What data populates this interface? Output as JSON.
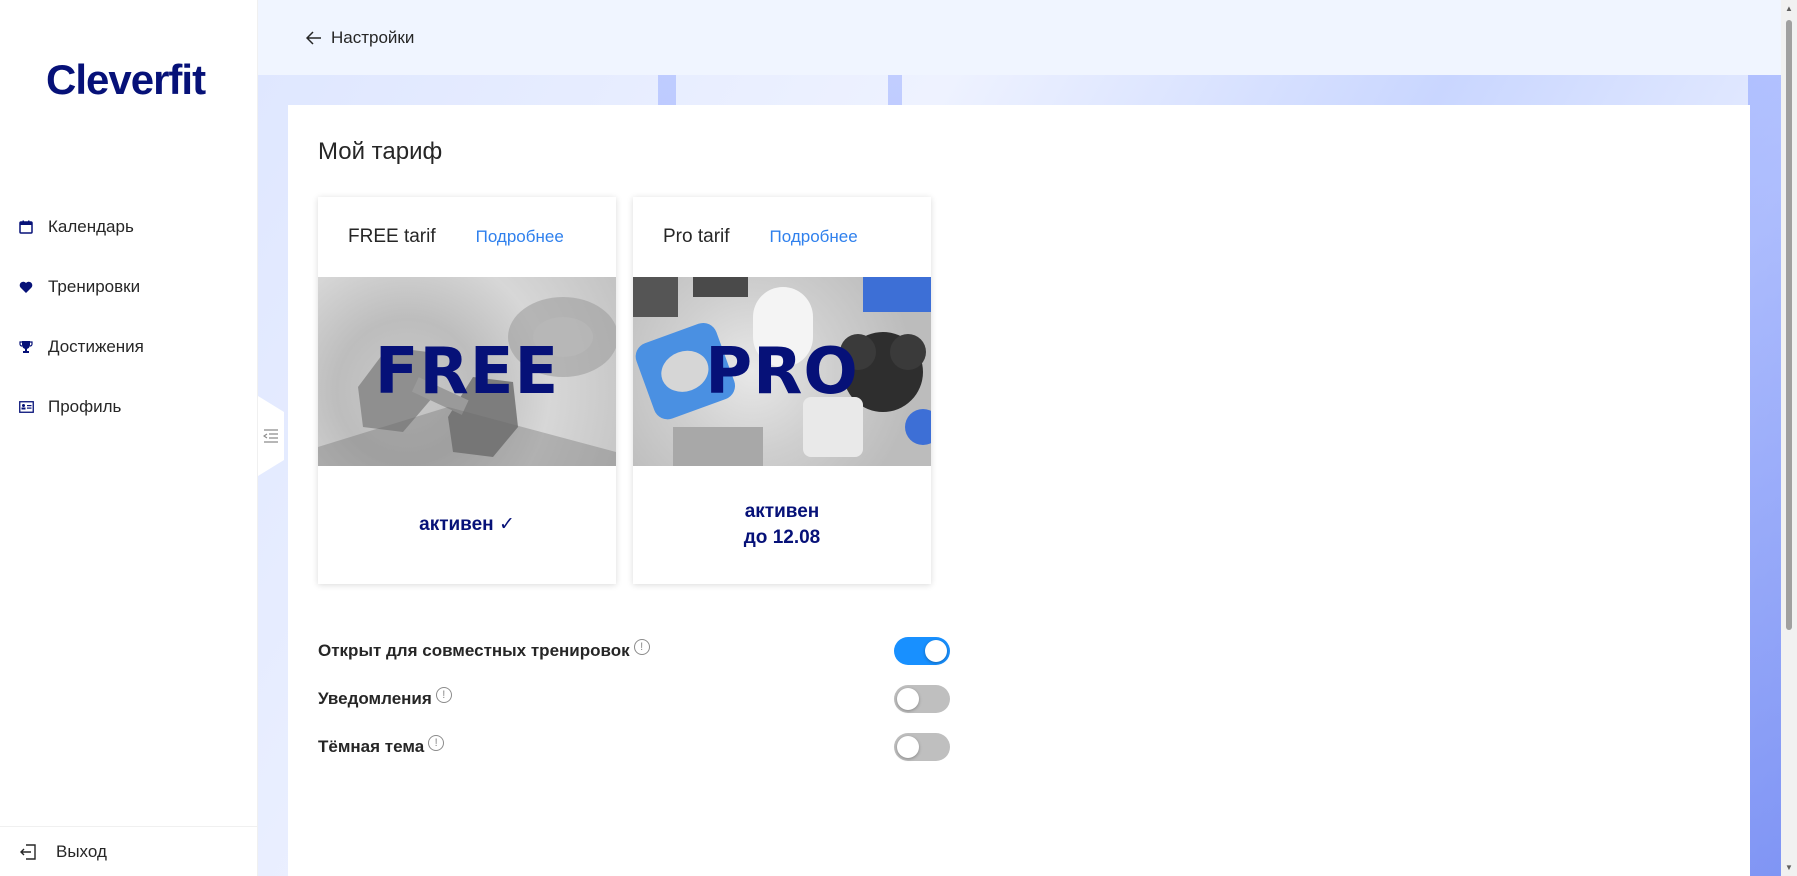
{
  "app": {
    "logo": "Cleverfit"
  },
  "sidebar": {
    "items": [
      {
        "label": "Календарь",
        "icon": "calendar-icon"
      },
      {
        "label": "Тренировки",
        "icon": "heart-icon"
      },
      {
        "label": "Достижения",
        "icon": "trophy-icon"
      },
      {
        "label": "Профиль",
        "icon": "id-card-icon"
      }
    ],
    "logout_label": "Выход"
  },
  "header": {
    "back_label": "Настройки"
  },
  "main": {
    "title": "Мой тариф",
    "tariffs": [
      {
        "name": "FREE tarif",
        "more": "Подробнее",
        "badge": "FREE",
        "status": "активен ✓",
        "status_line2": ""
      },
      {
        "name": "Pro tarif",
        "more": "Подробнее",
        "badge": "PRO",
        "status": "активен",
        "status_line2": "до 12.08"
      }
    ],
    "settings": [
      {
        "label": "Открыт для совместных тренировок",
        "enabled": true
      },
      {
        "label": "Уведомления",
        "enabled": false
      },
      {
        "label": "Тёмная тема",
        "enabled": false
      }
    ]
  },
  "colors": {
    "brand": "#061178",
    "accent": "#1890ff",
    "link": "#2f80ed"
  }
}
